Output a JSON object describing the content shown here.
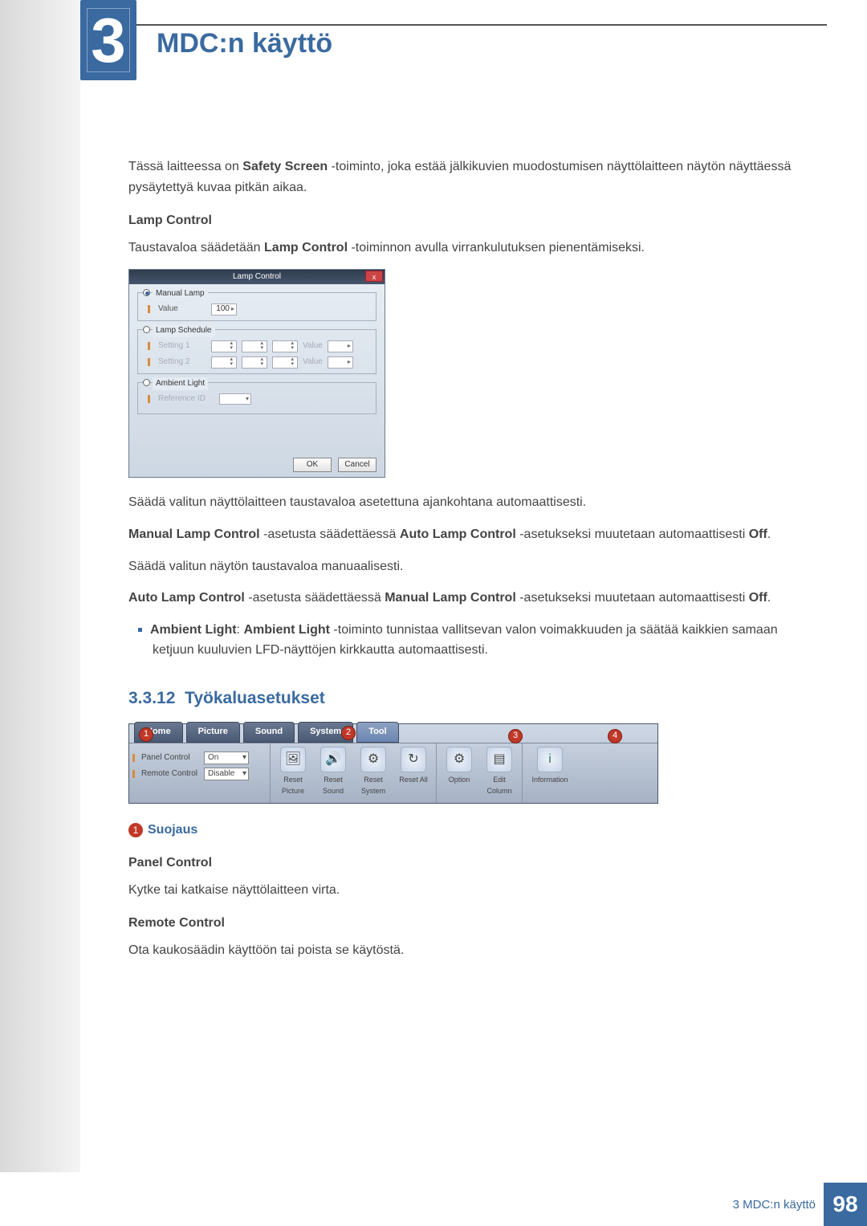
{
  "chapter": {
    "number": "3",
    "title": "MDC:n käyttö"
  },
  "intro": {
    "p1a": "Tässä laitteessa on ",
    "p1b_bold": "Safety Screen",
    "p1c": " -toiminto, joka estää jälkikuvien muodostumisen näyttölaitteen näytön näyttäessä pysäytettyä kuvaa pitkän aikaa."
  },
  "lamp": {
    "heading": "Lamp Control",
    "desc_a": "Taustavaloa säädetään ",
    "desc_b_bold": "Lamp Control",
    "desc_c": " -toiminnon avulla virrankulutuksen pienentämiseksi.",
    "dialog": {
      "title": "Lamp Control",
      "close": "x",
      "manual_legend": "Manual Lamp",
      "value_label": "Value",
      "value": "100",
      "schedule_legend": "Lamp Schedule",
      "setting1": "Setting 1",
      "setting2": "Setting 2",
      "value_ph": "Value",
      "ambient_legend": "Ambient Light",
      "ref_label": "Reference ID",
      "ok": "OK",
      "cancel": "Cancel"
    },
    "after1": "Säädä valitun näyttölaitteen taustavaloa asetettuna ajankohtana automaattisesti.",
    "after2_a_bold": "Manual Lamp Control",
    "after2_b": " -asetusta säädettäessä ",
    "after2_c_bold": "Auto Lamp Control",
    "after2_d": " -asetukseksi muutetaan automaattisesti ",
    "after2_e_bold": "Off",
    "after2_f": ".",
    "after3": "Säädä valitun näytön taustavaloa manuaalisesti.",
    "after4_a_bold": "Auto Lamp Control",
    "after4_b": " -asetusta säädettäessä ",
    "after4_c_bold": "Manual Lamp Control",
    "after4_d": " -asetukseksi muutetaan automaattisesti ",
    "after4_e_bold": "Off",
    "after4_f": ".",
    "bullet_a_bold": "Ambient Light",
    "bullet_b": ": ",
    "bullet_c_bold": "Ambient Light",
    "bullet_d": " -toiminto tunnistaa vallitsevan valon voimakkuuden ja säätää kaikkien samaan ketjuun kuuluvien LFD-näyttöjen kirkkautta automaattisesti."
  },
  "tools": {
    "section_no": "3.3.12",
    "section_title": "Työkaluasetukset",
    "tabs": {
      "home": "Home",
      "picture": "Picture",
      "sound": "Sound",
      "system": "System",
      "tool": "Tool"
    },
    "panel": {
      "panel_control": "Panel Control",
      "panel_value": "On",
      "remote_control": "Remote Control",
      "remote_value": "Disable"
    },
    "items": {
      "reset_picture": "Reset Picture",
      "reset_sound": "Reset Sound",
      "reset_system": "Reset System",
      "reset_all": "Reset All",
      "option": "Option",
      "edit_column": "Edit Column",
      "information": "Information"
    },
    "markers": {
      "m1": "1",
      "m2": "2",
      "m3": "3",
      "m4": "4"
    },
    "suojaus_label": "Suojaus",
    "panel_head": "Panel Control",
    "panel_body": "Kytke tai katkaise näyttölaitteen virta.",
    "remote_head": "Remote Control",
    "remote_body": "Ota kaukosäädin käyttöön tai poista se käytöstä."
  },
  "footer": {
    "text": "3 MDC:n käyttö",
    "page": "98"
  }
}
